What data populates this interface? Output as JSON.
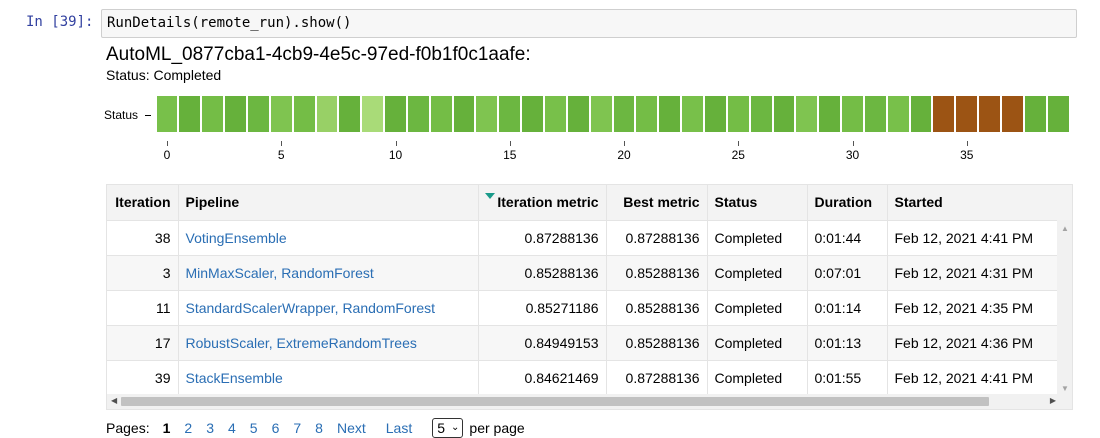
{
  "cell": {
    "prompt": "In [39]:",
    "code": "RunDetails(remote_run).show()"
  },
  "run": {
    "title": "AutoML_0877cba1-4cb9-4e5c-97ed-f0b1f0c1aafe:",
    "status_label": "Status:",
    "status_value": "Completed"
  },
  "chart_data": {
    "type": "bar",
    "ylabel": "Status",
    "x_ticks": [
      "0",
      "5",
      "10",
      "15",
      "20",
      "25",
      "30",
      "35"
    ],
    "iterations": [
      0,
      1,
      2,
      3,
      4,
      5,
      6,
      7,
      8,
      9,
      10,
      11,
      12,
      13,
      14,
      15,
      16,
      17,
      18,
      19,
      20,
      21,
      22,
      23,
      24,
      25,
      26,
      27,
      28,
      29,
      30,
      31,
      32,
      33,
      34,
      35,
      36,
      37,
      38,
      39
    ],
    "statuses": [
      "Completed",
      "Completed",
      "Completed",
      "Completed",
      "Completed",
      "Completed",
      "Completed",
      "Completed",
      "Completed",
      "Completed",
      "Completed",
      "Completed",
      "Completed",
      "Completed",
      "Completed",
      "Completed",
      "Completed",
      "Completed",
      "Completed",
      "Completed",
      "Completed",
      "Completed",
      "Completed",
      "Completed",
      "Completed",
      "Completed",
      "Completed",
      "Completed",
      "Completed",
      "Completed",
      "Completed",
      "Completed",
      "Completed",
      "Completed",
      "Canceled",
      "Canceled",
      "Canceled",
      "Canceled",
      "Completed",
      "Completed"
    ],
    "colors": [
      "#78c04a",
      "#66b13b",
      "#74bd46",
      "#66b13b",
      "#6cb741",
      "#7fc450",
      "#74bd46",
      "#98d066",
      "#66b13b",
      "#a9db78",
      "#66b13b",
      "#6cb741",
      "#74bd46",
      "#66b13b",
      "#7fc450",
      "#6cb741",
      "#66b13b",
      "#78c04a",
      "#66b13b",
      "#7fc450",
      "#6cb741",
      "#74bd46",
      "#66b13b",
      "#78c04a",
      "#66b13b",
      "#74bd46",
      "#6cb741",
      "#66b13b",
      "#7fc450",
      "#66b13b",
      "#74bd46",
      "#6cb741",
      "#78c04a",
      "#66b13b",
      "#9c5414",
      "#9c5414",
      "#9c5414",
      "#9c5414",
      "#66b13b",
      "#66b13b"
    ],
    "xlim": [
      -0.5,
      39.5
    ]
  },
  "table": {
    "columns": [
      "Iteration",
      "Pipeline",
      "Iteration metric",
      "Best metric",
      "Status",
      "Duration",
      "Started"
    ],
    "rows": [
      {
        "iteration": "38",
        "pipeline": "VotingEnsemble",
        "iteration_metric": "0.87288136",
        "best_metric": "0.87288136",
        "status": "Completed",
        "duration": "0:01:44",
        "started": "Feb 12, 2021 4:41 PM"
      },
      {
        "iteration": "3",
        "pipeline": "MinMaxScaler, RandomForest",
        "iteration_metric": "0.85288136",
        "best_metric": "0.85288136",
        "status": "Completed",
        "duration": "0:07:01",
        "started": "Feb 12, 2021 4:31 PM"
      },
      {
        "iteration": "11",
        "pipeline": "StandardScalerWrapper, RandomForest",
        "iteration_metric": "0.85271186",
        "best_metric": "0.85288136",
        "status": "Completed",
        "duration": "0:01:14",
        "started": "Feb 12, 2021 4:35 PM"
      },
      {
        "iteration": "17",
        "pipeline": "RobustScaler, ExtremeRandomTrees",
        "iteration_metric": "0.84949153",
        "best_metric": "0.85288136",
        "status": "Completed",
        "duration": "0:01:13",
        "started": "Feb 12, 2021 4:36 PM"
      },
      {
        "iteration": "39",
        "pipeline": "StackEnsemble",
        "iteration_metric": "0.84621469",
        "best_metric": "0.87288136",
        "status": "Completed",
        "duration": "0:01:55",
        "started": "Feb 12, 2021 4:41 PM"
      }
    ]
  },
  "pager": {
    "label": "Pages:",
    "current": "1",
    "pages": [
      "1",
      "2",
      "3",
      "4",
      "5",
      "6",
      "7",
      "8"
    ],
    "next": "Next",
    "last": "Last",
    "page_size": "5",
    "per_page": "per page"
  }
}
